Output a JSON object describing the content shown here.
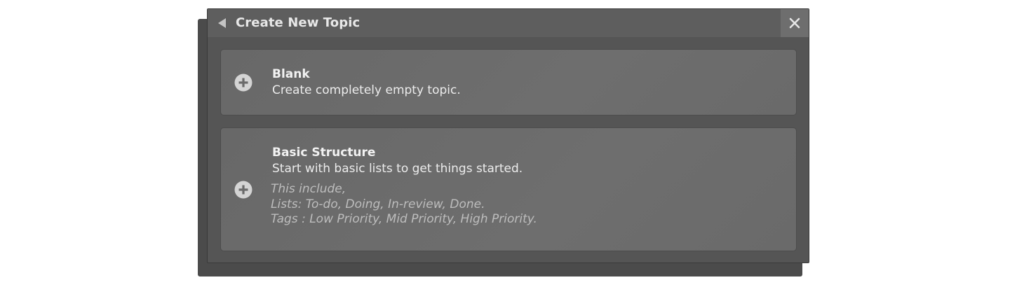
{
  "dialog": {
    "title": "Create New Topic",
    "back_icon": "back-arrow-icon",
    "close_icon": "close-icon"
  },
  "options": [
    {
      "title": "Blank",
      "description": "Create completely empty topic.",
      "icon": "plus-circle-icon"
    },
    {
      "title": "Basic Structure",
      "description": "Start with basic lists to get things started.",
      "icon": "plus-circle-icon",
      "details": [
        "This include,",
        "Lists: To-do, Doing, In-review, Done.",
        "Tags : Low Priority, Mid Priority, High Priority."
      ]
    }
  ],
  "colors": {
    "dialog_bg": "#555555",
    "header_bg": "#5e5e5e",
    "card_bg": "#6b6b6b",
    "close_bg": "#6e6e6e"
  }
}
